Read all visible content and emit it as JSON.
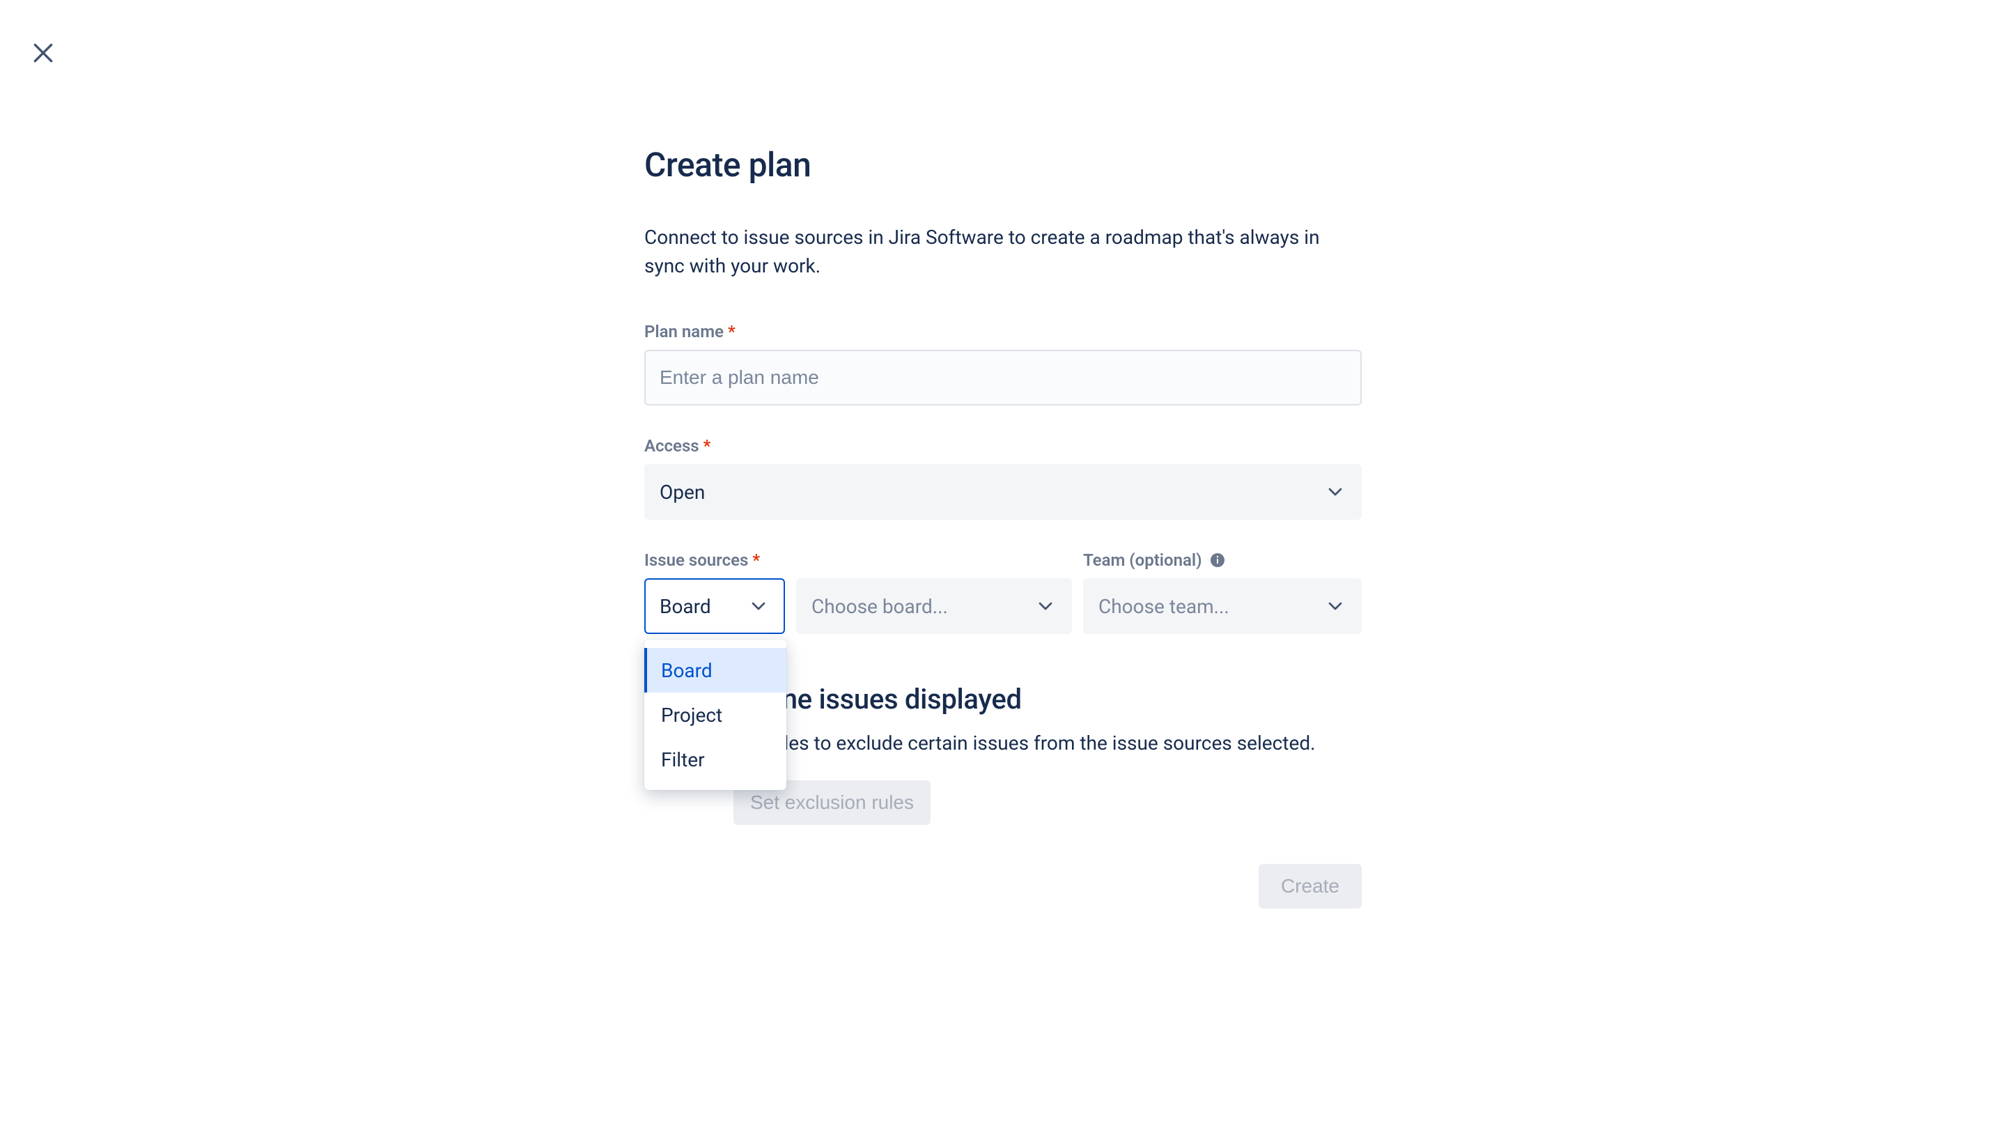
{
  "dialog": {
    "title": "Create plan",
    "description": "Connect to issue sources in Jira Software to create a roadmap that's always in sync with your work."
  },
  "fields": {
    "plan_name": {
      "label": "Plan name",
      "placeholder": "Enter a plan name",
      "value": "",
      "required": true
    },
    "access": {
      "label": "Access",
      "value": "Open",
      "required": true
    },
    "issue_sources": {
      "label": "Issue sources",
      "required": true,
      "type_select_value": "Board",
      "type_options": [
        "Board",
        "Project",
        "Filter"
      ],
      "board_placeholder": "Choose board..."
    },
    "team": {
      "label": "Team (optional)",
      "placeholder": "Choose team..."
    }
  },
  "refine": {
    "title": "Refine issues displayed",
    "description": "Set rules to exclude certain issues from the issue sources selected.",
    "button": "Set exclusion rules"
  },
  "footer": {
    "create": "Create"
  },
  "required_mark": "*"
}
